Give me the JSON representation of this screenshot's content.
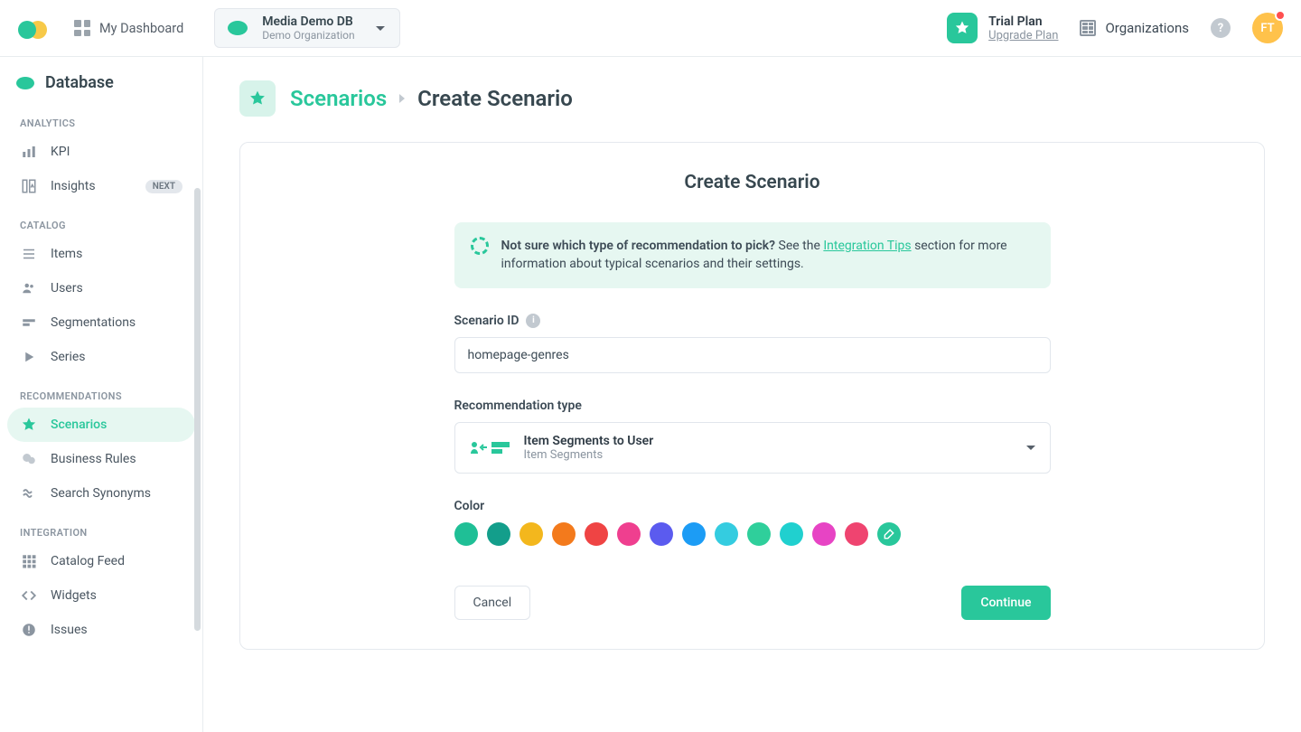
{
  "header": {
    "dashboard_label": "My Dashboard",
    "db_name": "Media Demo DB",
    "db_org": "Demo Organization",
    "trial_title": "Trial Plan",
    "trial_upgrade": "Upgrade Plan",
    "orgs_label": "Organizations",
    "help_glyph": "?",
    "avatar_initials": "FT"
  },
  "sidebar": {
    "title": "Database",
    "groups": {
      "analytics": "ANALYTICS",
      "catalog": "CATALOG",
      "recommendations": "RECOMMENDATIONS",
      "integration": "INTEGRATION"
    },
    "items": {
      "kpi": "KPI",
      "insights": "Insights",
      "insights_badge": "NEXT",
      "items": "Items",
      "users": "Users",
      "segmentations": "Segmentations",
      "series": "Series",
      "scenarios": "Scenarios",
      "business_rules": "Business Rules",
      "search_synonyms": "Search Synonyms",
      "catalog_feed": "Catalog Feed",
      "widgets": "Widgets",
      "issues": "Issues"
    }
  },
  "breadcrumb": {
    "link": "Scenarios",
    "current": "Create Scenario"
  },
  "form": {
    "title": "Create Scenario",
    "tip_bold": "Not sure which type of recommendation to pick?",
    "tip_middle": " See the ",
    "tip_link": "Integration Tips",
    "tip_rest": " section for more information about typical scenarios and their settings.",
    "scenario_id_label": "Scenario ID",
    "scenario_id_value": "homepage-genres",
    "rec_type_label": "Recommendation type",
    "rec_selected_title": "Item Segments to User",
    "rec_selected_sub": "Item Segments",
    "color_label": "Color",
    "colors": [
      "#1fbf96",
      "#139e8b",
      "#f3b71d",
      "#f37a1c",
      "#ef4444",
      "#ef3f8f",
      "#5b5bef",
      "#1c9cf5",
      "#34cce0",
      "#2fcf9b",
      "#20d0cf",
      "#e744c4",
      "#ef4470",
      "#29c79b"
    ],
    "cancel": "Cancel",
    "continue": "Continue"
  }
}
